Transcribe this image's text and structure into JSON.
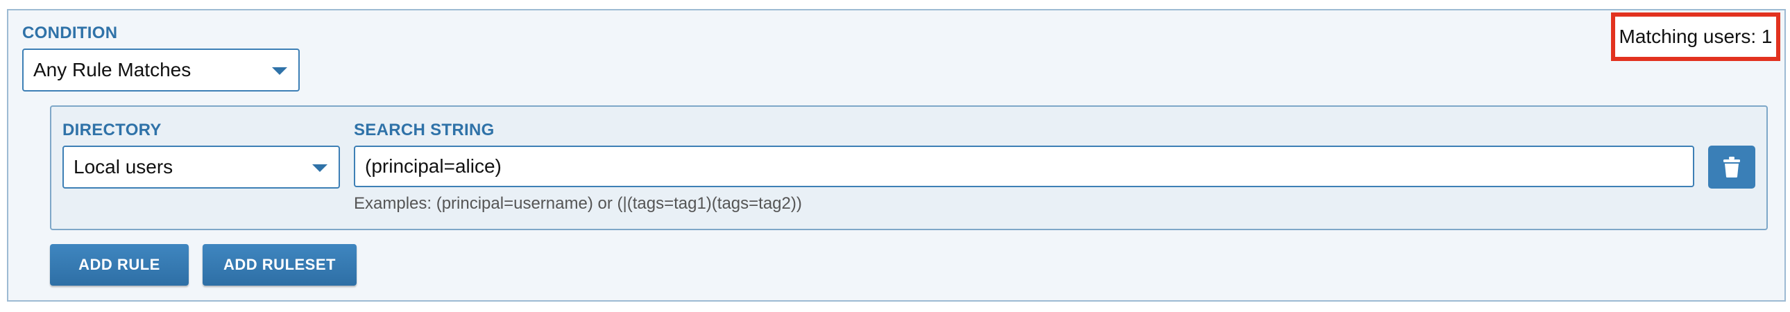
{
  "condition": {
    "label": "CONDITION",
    "selected": "Any Rule Matches"
  },
  "matching": {
    "text": "Matching users: 1",
    "highlight_color": "#e2321f"
  },
  "rule": {
    "directory_label": "DIRECTORY",
    "directory_selected": "Local users",
    "search_label": "SEARCH STRING",
    "search_value": "(principal=alice)",
    "hint": "Examples: (principal=username) or (|(tags=tag1)(tags=tag2))",
    "delete_icon": "trash-icon"
  },
  "actions": {
    "add_rule": "ADD RULE",
    "add_ruleset": "ADD RULESET"
  },
  "colors": {
    "accent": "#2f72a8",
    "panel_bg": "#f2f6fa"
  }
}
